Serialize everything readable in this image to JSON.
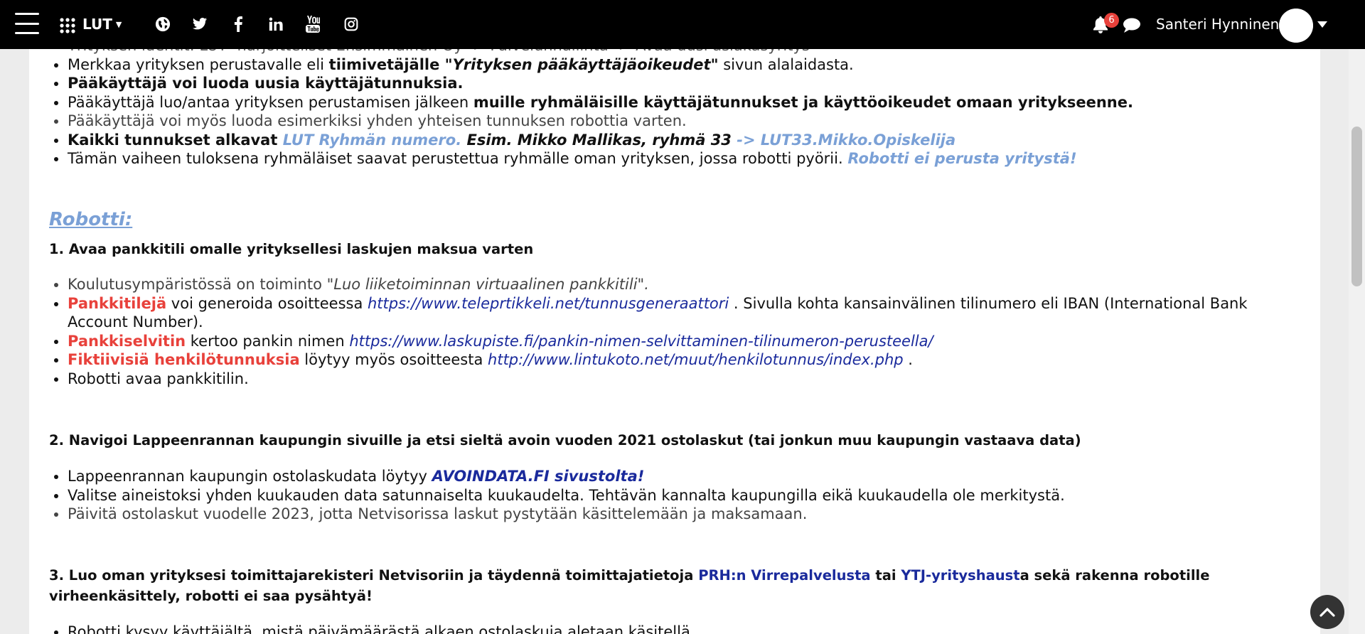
{
  "topbar": {
    "brand": "LUT",
    "notification_count": "6",
    "user_name": "Santeri Hynninen",
    "icons": [
      "menu-icon",
      "apps-grid-icon",
      "globe-icon",
      "twitter-icon",
      "facebook-icon",
      "linkedin-icon",
      "youtube-icon",
      "instagram-icon",
      "bell-icon",
      "chat-icon",
      "avatar",
      "chevron-down-icon"
    ]
  },
  "intro_list": {
    "cut_line": "Yrityksen identit: LUT -harjoitteliset Ensimmäinen Oy -> Palvelunhallinta -> Avaa uusi asiakasyritys",
    "item1": {
      "a": "Merkkaa yrityksen perustavalle eli ",
      "b": "tiimivetäjälle ",
      "c": "\"Yrityksen pääkäyttäjäoikeudet\"",
      "d": " sivun alalaidasta."
    },
    "item2": "Pääkäyttäjä voi luoda uusia käyttäjätunnuksia.",
    "item3": {
      "a": "Pääkäyttäjä luo/antaa yrityksen perustamisen jälkeen ",
      "b": "muille ryhmäläisille käyttäjätunnukset ja käyttöoikeudet omaan yritykseenne."
    },
    "item4": "Pääkäyttäjä voi myös luoda esimerkiksi yhden yhteisen tunnuksen robottia varten.",
    "item5": {
      "a": "Kaikki tunnukset alkavat ",
      "b": "LUT Ryhmän numero.",
      "c": " Esim. Mikko Mallikas, ryhmä 33 ",
      "d": "-> LUT33.Mikko.Opiskelija"
    },
    "item6": {
      "a": "Tämän vaiheen tuloksena ryhmäläiset saavat perustettua ryhmälle oman yrityksen, jossa robotti pyörii. ",
      "b": "Robotti ei perusta yritystä!"
    }
  },
  "robot_heading": "Robotti:",
  "step1": {
    "title": "1. Avaa pankkitili omalle yrityksellesi laskujen maksua varten",
    "item1": {
      "a": "Koulutusympäristössä on toiminto ",
      "b": "\"Luo liiketoiminnan virtuaalinen pankkitili\"."
    },
    "item2": {
      "a": "Pankkitilejä",
      "b": " voi generoida osoitteessa ",
      "c": "https://www.teleprtikkeli.net/tunnusgeneraattori",
      "d": " . Sivulla kohta kansainvälinen tilinumero eli IBAN (International Bank Account Number)."
    },
    "item3": {
      "a": "Pankkiselvitin",
      "b": " kertoo pankin nimen ",
      "c": "https://www.laskupiste.fi/pankin-nimen-selvittaminen-tilinumeron-perusteella/"
    },
    "item4": {
      "a": "Fiktiivisiä henkilötunnuksia",
      "b": " löytyy myös osoitteesta ",
      "c": "http://www.lintukoto.net/muut/henkilotunnus/index.php",
      "d": " ."
    },
    "item5": "Robotti avaa pankkitilin."
  },
  "step2": {
    "title": "2. Navigoi Lappeenrannan kaupungin sivuille ja etsi sieltä avoin vuoden 2021 ostolaskut (tai jonkun muu kaupungin vastaava data)",
    "item1": {
      "a": "Lappeenrannan kaupungin ostolaskudata löytyy ",
      "b": "AVOINDATA.FI sivustolta!"
    },
    "item2": "Valitse aineistoksi yhden kuukauden data satunnaiselta kuukaudelta. Tehtävän kannalta kaupungilla eikä kuukaudella ole merkitystä.",
    "item3": "Päivitä ostolaskut vuodelle 2023, jotta Netvisorissa laskut pystytään käsittelemään ja maksamaan."
  },
  "step3": {
    "a": "3. Luo oman yrityksesi toimittajarekisteri Netvisoriin ja täydennä toimittajatietoja ",
    "b": "PRH:n Virrepalvelusta",
    "c": " tai ",
    "d": "YTJ-yrityshaust",
    "e": "a sekä rakenna robotille virheenkäsittely, robotti ei saa pysähtyä!",
    "cut_item": "Robotti kysyy käyttäjältä, mistä päivämäärästä alkaen ostolaskuja aletaan käsitellä."
  }
}
